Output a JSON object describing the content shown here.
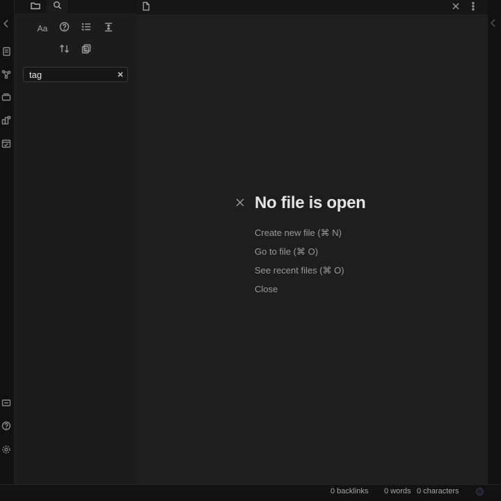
{
  "sidebar": {
    "tabs": [
      {
        "icon": "folder-icon",
        "label": ""
      },
      {
        "icon": "search-icon",
        "label": ""
      }
    ],
    "tools": [
      {
        "icon": "match-case-icon",
        "glyph": "Aa"
      },
      {
        "icon": "help-circle-icon"
      },
      {
        "icon": "list-icon"
      },
      {
        "icon": "expand-vertical-icon"
      },
      {
        "icon": "sort-icon"
      },
      {
        "icon": "copy-results-icon"
      }
    ],
    "search": {
      "value": "tag",
      "placeholder": ""
    }
  },
  "ribbon": {
    "icons": [
      "collapse-left-icon",
      "files-icon",
      "graph-icon",
      "canvas-icon",
      "plugins-icon",
      "calendar-icon",
      "vault-switch-icon",
      "help-icon",
      "settings-icon"
    ]
  },
  "main": {
    "empty_state": {
      "title": "No file is open",
      "actions": [
        {
          "label": "Create new file (⌘ N)"
        },
        {
          "label": "Go to file (⌘ O)"
        },
        {
          "label": "See recent files (⌘ O)"
        },
        {
          "label": "Close"
        }
      ]
    }
  },
  "statusbar": {
    "backlinks": "0 backlinks",
    "words": "0 words",
    "characters": "0 characters"
  },
  "colors": {
    "background": "#1e1e1e",
    "sidebar": "#1c1c1c",
    "accent": "#7b6cd9"
  }
}
